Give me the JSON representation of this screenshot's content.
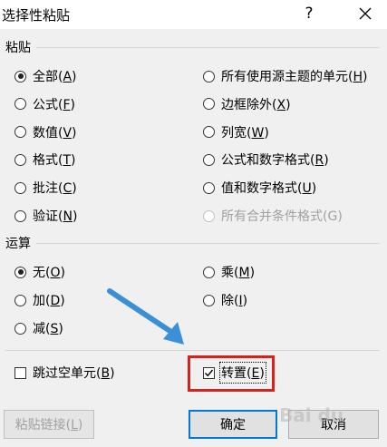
{
  "dialog": {
    "title": "选择性粘贴",
    "help": "?"
  },
  "paste": {
    "label": "粘贴",
    "left": [
      {
        "text": "全部",
        "key": "A",
        "checked": true
      },
      {
        "text": "公式",
        "key": "F",
        "checked": false
      },
      {
        "text": "数值",
        "key": "V",
        "checked": false
      },
      {
        "text": "格式",
        "key": "T",
        "checked": false
      },
      {
        "text": "批注",
        "key": "C",
        "checked": false
      },
      {
        "text": "验证",
        "key": "N",
        "checked": false
      }
    ],
    "right": [
      {
        "text": "所有使用源主题的单元",
        "key": "H",
        "checked": false
      },
      {
        "text": "边框除外",
        "key": "X",
        "checked": false
      },
      {
        "text": "列宽",
        "key": "W",
        "checked": false
      },
      {
        "text": "公式和数字格式",
        "key": "R",
        "checked": false
      },
      {
        "text": "值和数字格式",
        "key": "U",
        "checked": false
      },
      {
        "text": "所有合并条件格式",
        "key": "G",
        "checked": false,
        "disabled": true
      }
    ]
  },
  "operation": {
    "label": "运算",
    "left": [
      {
        "text": "无",
        "key": "O",
        "checked": true
      },
      {
        "text": "加",
        "key": "D",
        "checked": false
      },
      {
        "text": "减",
        "key": "S",
        "checked": false
      }
    ],
    "right": [
      {
        "text": "乘",
        "key": "M",
        "checked": false
      },
      {
        "text": "除",
        "key": "I",
        "checked": false
      }
    ]
  },
  "options": {
    "skip_blanks": {
      "text": "跳过空单元",
      "key": "B",
      "checked": false
    },
    "transpose": {
      "text": "转置",
      "key": "E",
      "checked": true
    }
  },
  "buttons": {
    "paste_link": {
      "text": "粘贴链接",
      "key": "L"
    },
    "ok": "确定",
    "cancel": "取消"
  },
  "watermark": "Bai du",
  "colors": {
    "highlight": "#d8211a",
    "arrow": "#3b8fd6",
    "focus": "#0078d7"
  }
}
